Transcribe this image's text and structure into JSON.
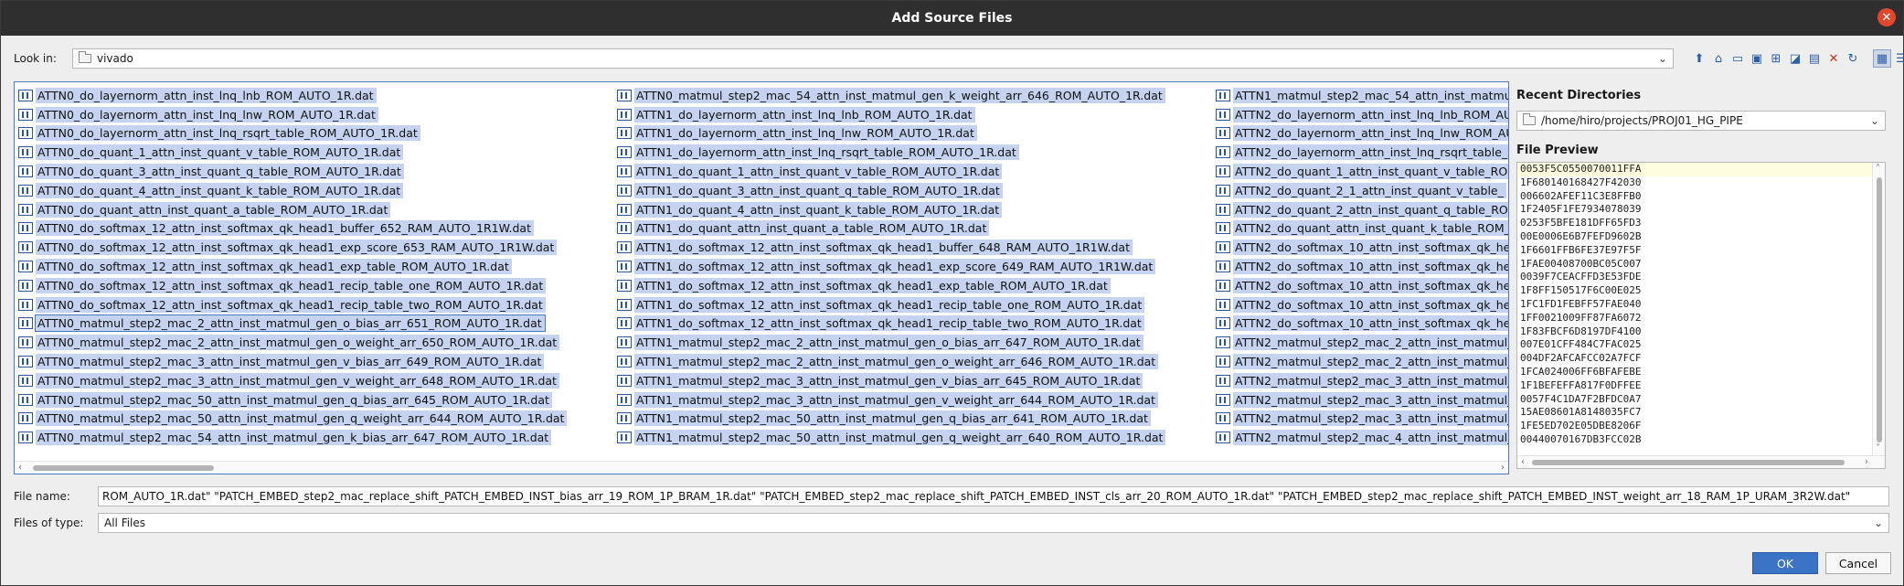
{
  "window": {
    "title": "Add Source Files",
    "close_glyph": "✕"
  },
  "look_in": {
    "label": "Look in:",
    "value": "vivado",
    "icon": "folder-icon",
    "toolbar_icons": [
      "up-folder-icon",
      "home-icon",
      "desktop-icon",
      "computer-icon",
      "network-icon",
      "bookmark-icon",
      "new-folder-icon",
      "delete-icon",
      "refresh-icon",
      "list-view-icon",
      "details-view-icon"
    ]
  },
  "files": {
    "columns": [
      [
        "ATTN0_do_layernorm_attn_inst_lnq_lnb_ROM_AUTO_1R.dat",
        "ATTN0_do_layernorm_attn_inst_lnq_lnw_ROM_AUTO_1R.dat",
        "ATTN0_do_layernorm_attn_inst_lnq_rsqrt_table_ROM_AUTO_1R.dat",
        "ATTN0_do_quant_1_attn_inst_quant_v_table_ROM_AUTO_1R.dat",
        "ATTN0_do_quant_3_attn_inst_quant_q_table_ROM_AUTO_1R.dat",
        "ATTN0_do_quant_4_attn_inst_quant_k_table_ROM_AUTO_1R.dat",
        "ATTN0_do_quant_attn_inst_quant_a_table_ROM_AUTO_1R.dat",
        "ATTN0_do_softmax_12_attn_inst_softmax_qk_head1_buffer_652_RAM_AUTO_1R1W.dat",
        "ATTN0_do_softmax_12_attn_inst_softmax_qk_head1_exp_score_653_RAM_AUTO_1R1W.dat",
        "ATTN0_do_softmax_12_attn_inst_softmax_qk_head1_exp_table_ROM_AUTO_1R.dat",
        "ATTN0_do_softmax_12_attn_inst_softmax_qk_head1_recip_table_one_ROM_AUTO_1R.dat",
        "ATTN0_do_softmax_12_attn_inst_softmax_qk_head1_recip_table_two_ROM_AUTO_1R.dat",
        "ATTN0_matmul_step2_mac_2_attn_inst_matmul_gen_o_bias_arr_651_ROM_AUTO_1R.dat",
        "ATTN0_matmul_step2_mac_2_attn_inst_matmul_gen_o_weight_arr_650_ROM_AUTO_1R.dat",
        "ATTN0_matmul_step2_mac_3_attn_inst_matmul_gen_v_bias_arr_649_ROM_AUTO_1R.dat",
        "ATTN0_matmul_step2_mac_3_attn_inst_matmul_gen_v_weight_arr_648_ROM_AUTO_1R.dat",
        "ATTN0_matmul_step2_mac_50_attn_inst_matmul_gen_q_bias_arr_645_ROM_AUTO_1R.dat",
        "ATTN0_matmul_step2_mac_50_attn_inst_matmul_gen_q_weight_arr_644_ROM_AUTO_1R.dat",
        "ATTN0_matmul_step2_mac_54_attn_inst_matmul_gen_k_bias_arr_647_ROM_AUTO_1R.dat"
      ],
      [
        "ATTN0_matmul_step2_mac_54_attn_inst_matmul_gen_k_weight_arr_646_ROM_AUTO_1R.dat",
        "ATTN1_do_layernorm_attn_inst_lnq_lnb_ROM_AUTO_1R.dat",
        "ATTN1_do_layernorm_attn_inst_lnq_lnw_ROM_AUTO_1R.dat",
        "ATTN1_do_layernorm_attn_inst_lnq_rsqrt_table_ROM_AUTO_1R.dat",
        "ATTN1_do_quant_1_attn_inst_quant_v_table_ROM_AUTO_1R.dat",
        "ATTN1_do_quant_3_attn_inst_quant_q_table_ROM_AUTO_1R.dat",
        "ATTN1_do_quant_4_attn_inst_quant_k_table_ROM_AUTO_1R.dat",
        "ATTN1_do_quant_attn_inst_quant_a_table_ROM_AUTO_1R.dat",
        "ATTN1_do_softmax_12_attn_inst_softmax_qk_head1_buffer_648_RAM_AUTO_1R1W.dat",
        "ATTN1_do_softmax_12_attn_inst_softmax_qk_head1_exp_score_649_RAM_AUTO_1R1W.dat",
        "ATTN1_do_softmax_12_attn_inst_softmax_qk_head1_exp_table_ROM_AUTO_1R.dat",
        "ATTN1_do_softmax_12_attn_inst_softmax_qk_head1_recip_table_one_ROM_AUTO_1R.dat",
        "ATTN1_do_softmax_12_attn_inst_softmax_qk_head1_recip_table_two_ROM_AUTO_1R.dat",
        "ATTN1_matmul_step2_mac_2_attn_inst_matmul_gen_o_bias_arr_647_ROM_AUTO_1R.dat",
        "ATTN1_matmul_step2_mac_2_attn_inst_matmul_gen_o_weight_arr_646_ROM_AUTO_1R.dat",
        "ATTN1_matmul_step2_mac_3_attn_inst_matmul_gen_v_bias_arr_645_ROM_AUTO_1R.dat",
        "ATTN1_matmul_step2_mac_3_attn_inst_matmul_gen_v_weight_arr_644_ROM_AUTO_1R.dat",
        "ATTN1_matmul_step2_mac_50_attn_inst_matmul_gen_q_bias_arr_641_ROM_AUTO_1R.dat",
        "ATTN1_matmul_step2_mac_50_attn_inst_matmul_gen_q_weight_arr_640_ROM_AUTO_1R.dat"
      ],
      [
        "ATTN1_matmul_step2_mac_54_attn_inst_matmu",
        "ATTN2_do_layernorm_attn_inst_lnq_lnb_ROM_AU",
        "ATTN2_do_layernorm_attn_inst_lnq_lnw_ROM_AU",
        "ATTN2_do_layernorm_attn_inst_lnq_rsqrt_table_",
        "ATTN2_do_quant_1_attn_inst_quant_v_table_RO",
        "ATTN2_do_quant_2_1_attn_inst_quant_v_table_",
        "ATTN2_do_quant_2_attn_inst_quant_q_table_RO",
        "ATTN2_do_quant_attn_inst_quant_k_table_ROM_",
        "ATTN2_do_softmax_10_attn_inst_softmax_qk_he",
        "ATTN2_do_softmax_10_attn_inst_softmax_qk_he",
        "ATTN2_do_softmax_10_attn_inst_softmax_qk_he",
        "ATTN2_do_softmax_10_attn_inst_softmax_qk_he",
        "ATTN2_do_softmax_10_attn_inst_softmax_qk_he",
        "ATTN2_matmul_step2_mac_2_attn_inst_matmul_",
        "ATTN2_matmul_step2_mac_2_attn_inst_matmul_",
        "ATTN2_matmul_step2_mac_3_attn_inst_matmul_",
        "ATTN2_matmul_step2_mac_3_attn_inst_matmul_",
        "ATTN2_matmul_step2_mac_3_attn_inst_matmul_",
        "ATTN2_matmul_step2_mac_4_attn_inst_matmul_"
      ]
    ],
    "focused_item": "ATTN0_matmul_step2_mac_2_attn_inst_matmul_gen_o_bias_arr_651_ROM_AUTO_1R.dat"
  },
  "recent": {
    "title": "Recent Directories",
    "value": "/home/hiro/projects/PROJ01_HG_PIPE"
  },
  "preview": {
    "title": "File Preview",
    "lines": [
      "0053F5C0550070011FFA",
      "1F680140168427F42030",
      "006602AFEF11C3E8FFB0",
      "1F2405F1FE7934078039",
      "0253F5BFE181DFF65FD3",
      "00E0006E6B7FEFD9602B",
      "1F6601FFB6FE37E97F5F",
      "1FAE00408700BC05C007",
      "0039F7CEACFFD3E53FDE",
      "1F8FF150517F6C00E025",
      "1FC1FD1FEBFF57FAE040",
      "1FF0021009FF87FA6072",
      "1F83FBCF6D8197DF4100",
      "007E01CFF484C7FAC025",
      "004DF2AFCAFCC02A7FCF",
      "1FCA024006FF6BFAFEBE",
      "1F1BEFEFFA817F0DFFEE",
      "0057F4C1DA7F2BFDC0A7",
      "15AE08601A8148035FC7",
      "1FE5ED702E05DBE8206F",
      "00440070167DB3FCC02B"
    ]
  },
  "file_name": {
    "label": "File name:",
    "value": "ROM_AUTO_1R.dat\" \"PATCH_EMBED_step2_mac_replace_shift_PATCH_EMBED_INST_bias_arr_19_ROM_1P_BRAM_1R.dat\" \"PATCH_EMBED_step2_mac_replace_shift_PATCH_EMBED_INST_cls_arr_20_ROM_AUTO_1R.dat\" \"PATCH_EMBED_step2_mac_replace_shift_PATCH_EMBED_INST_weight_arr_18_RAM_1P_URAM_3R2W.dat\""
  },
  "file_type": {
    "label": "Files of type:",
    "value": "All Files"
  },
  "buttons": {
    "ok": "OK",
    "cancel": "Cancel"
  },
  "colors": {
    "selection": "#c5d3f0",
    "accent": "#3b73c7",
    "titlebar": "#2f2f2f",
    "close": "#e0482e"
  }
}
